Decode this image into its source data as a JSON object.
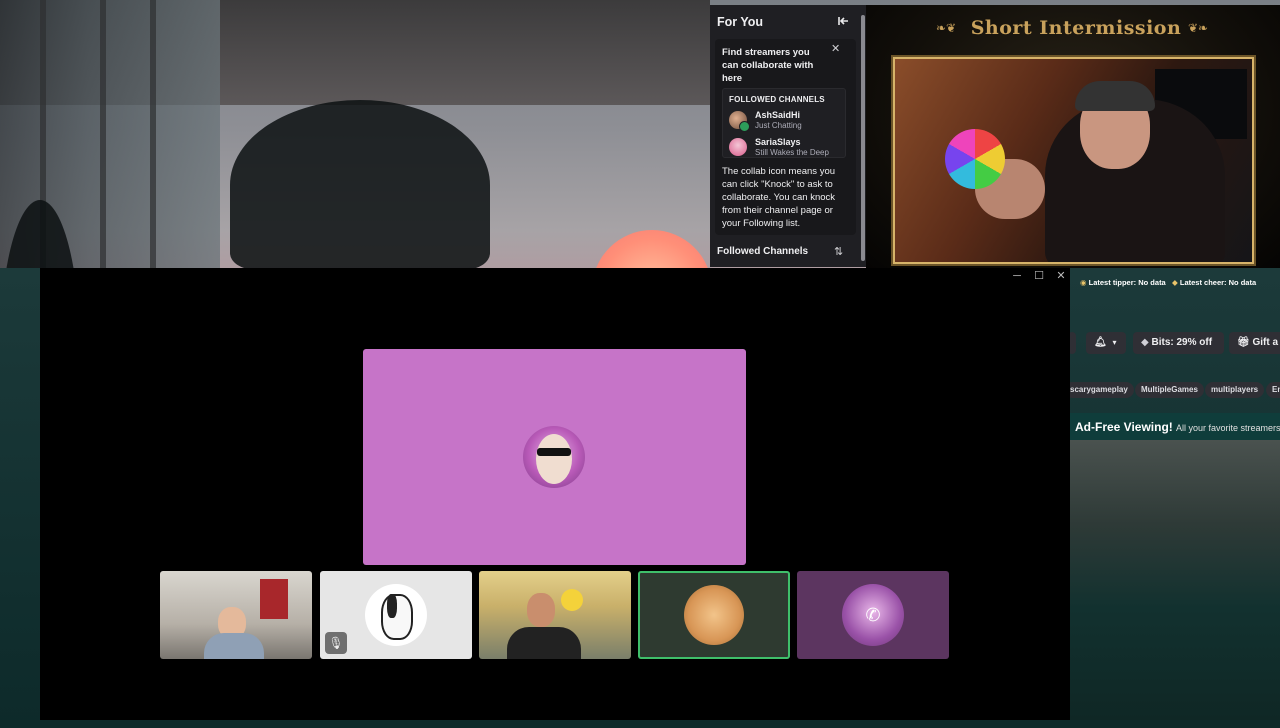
{
  "sidebar_popover": {
    "header": "For You",
    "tip": {
      "title": "Find streamers you can collaborate with here",
      "mini_list": {
        "heading": "FOLLOWED CHANNELS",
        "items": [
          {
            "name": "AshSaidHi",
            "category": "Just Chatting"
          },
          {
            "name": "SariaSlays",
            "category": "Still Wakes the Deep"
          }
        ]
      },
      "body": "The collab icon means you can click \"Knock\" to ask to collaborate. You can knock from their channel page or your Following list."
    },
    "footer_label": "Followed Channels"
  },
  "stream": {
    "overlay_title": "Short Intermission",
    "alerts": [
      {
        "label": "Latest tipper: No data"
      },
      {
        "label": "Latest cheer: No data"
      }
    ]
  },
  "channel_actions": {
    "bits_label": "Bits: 29% off",
    "gift_label": "Gift a S"
  },
  "tags": [
    "scarygameplay",
    "MultipleGames",
    "multiplayers",
    "En"
  ],
  "promo": {
    "title": "Ad-Free Viewing!",
    "subtitle": "All your favorite streamers"
  },
  "call": {
    "participants": [
      {
        "id": "speaker",
        "tile_color": "#c674c8"
      },
      {
        "id": "p1"
      },
      {
        "id": "p2",
        "muted": true
      },
      {
        "id": "p3"
      },
      {
        "id": "p4",
        "active_speaker": true
      },
      {
        "id": "p5",
        "tile_color": "#5c3560"
      }
    ]
  },
  "colors": {
    "twitch_panel": "#1f1f23",
    "speaker_tile": "#c674c8",
    "active_border": "#3fbf6a",
    "overlay_gold": "#c9a25c"
  }
}
